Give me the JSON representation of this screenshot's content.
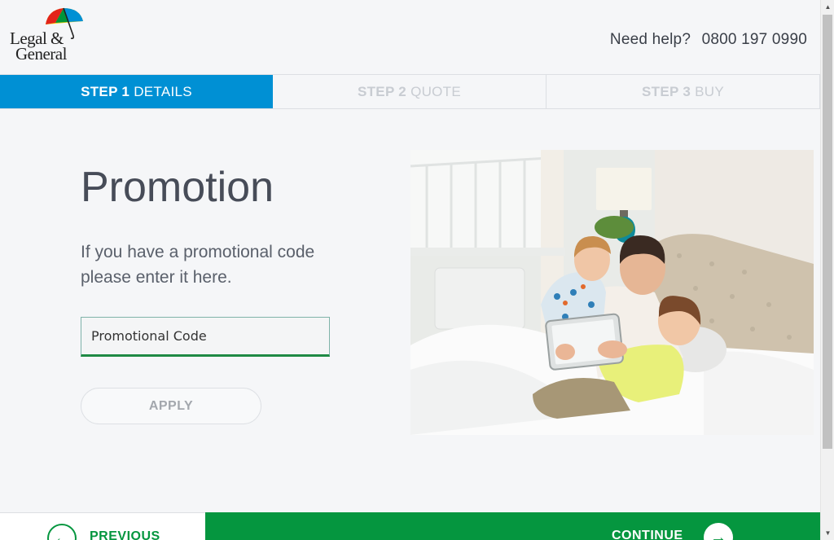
{
  "brand": {
    "name_line1": "Legal &",
    "name_line2": "General",
    "accent_colors": [
      "#e2231a",
      "#ffd200",
      "#00953b",
      "#0090d4"
    ]
  },
  "header": {
    "help_label": "Need help?",
    "help_phone": "0800 197 0990"
  },
  "steps": [
    {
      "prefix": "STEP 1",
      "label": "DETAILS",
      "active": true
    },
    {
      "prefix": "STEP 2",
      "label": "QUOTE",
      "active": false
    },
    {
      "prefix": "STEP 3",
      "label": "BUY",
      "active": false
    }
  ],
  "main": {
    "title": "Promotion",
    "description": "If you have a promotional code please enter it here.",
    "promo_input": {
      "placeholder": "Promotional Code",
      "value": ""
    },
    "apply_label": "APPLY"
  },
  "footer": {
    "previous_label": "PREVIOUS",
    "previous_icon": "arrow-left-icon",
    "continue_label": "CONTINUE",
    "continue_icon": "arrow-right-icon"
  },
  "colors": {
    "step_active": "#0090d4",
    "primary_green": "#05963f"
  }
}
